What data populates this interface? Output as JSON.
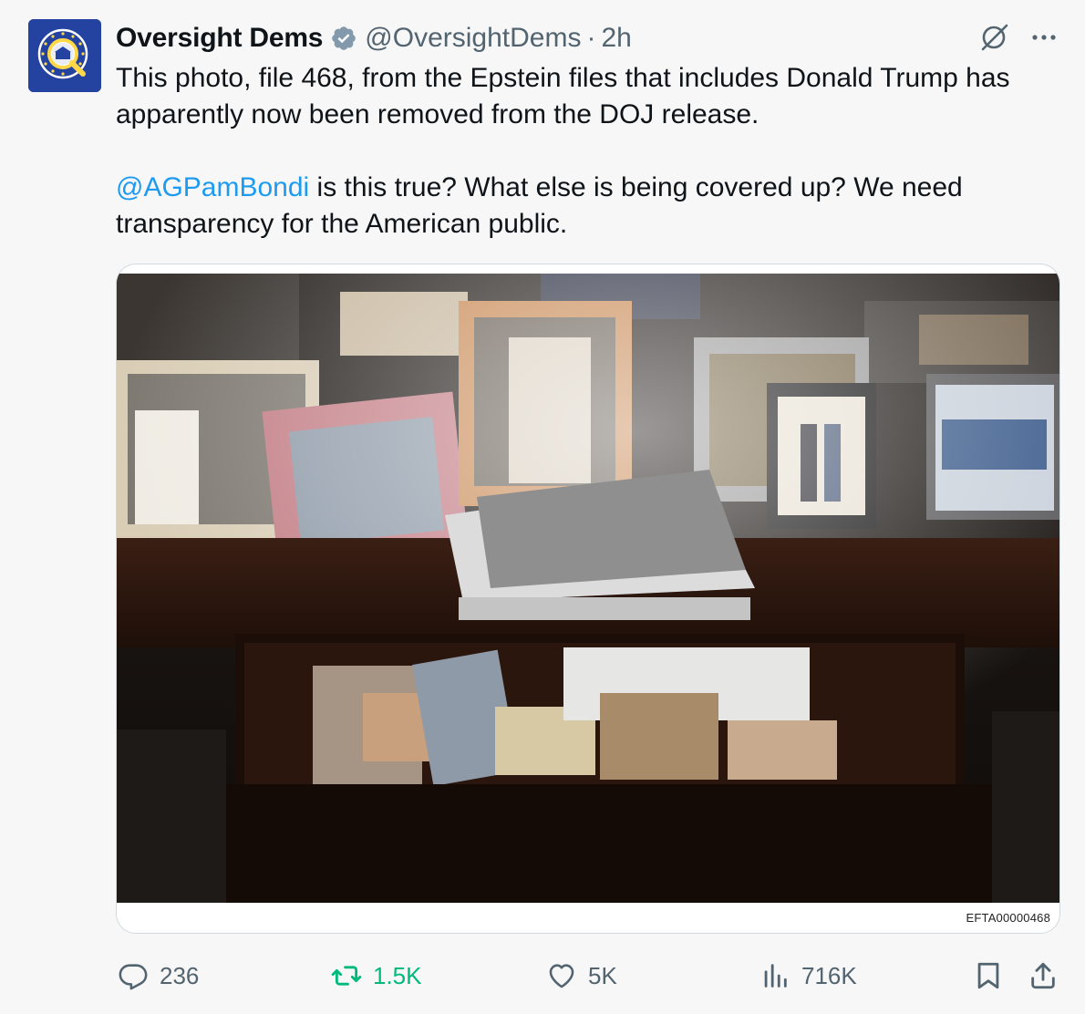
{
  "post": {
    "display_name": "Oversight Dems",
    "handle": "@OversightDems",
    "separator": "·",
    "time": "2h",
    "text_line1": "This photo, file 468, from the Epstein files that includes Donald Trump has apparently now been removed from the DOJ release.",
    "mention": "@AGPamBondi",
    "text_line2_rest": " is this true? What else is being covered up? We need transparency for the American public."
  },
  "media": {
    "file_code": "EFTA00000468"
  },
  "actions": {
    "replies": "236",
    "reposts": "1.5K",
    "likes": "5K",
    "views": "716K"
  },
  "colors": {
    "accent": "#1d9bf0",
    "repost_green": "#00ba7c",
    "muted": "#536471",
    "verified_badge": "#829aab"
  },
  "icons": [
    "grok-icon",
    "more-icon",
    "verified-icon",
    "reply-icon",
    "repost-icon",
    "like-icon",
    "views-icon",
    "bookmark-icon",
    "share-icon"
  ]
}
